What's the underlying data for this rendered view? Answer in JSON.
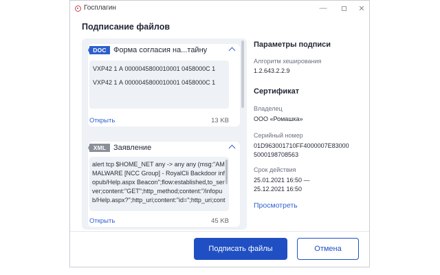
{
  "window": {
    "app_title": "Госплагин",
    "heading": "Подписание файлов"
  },
  "files": [
    {
      "badge": "DOC",
      "name": "Форма согласия на...тайну",
      "lines": [
        "VXP42   1 А 0000045800010001 0458000С 1",
        "VXP42   1 А 0000045800010001 0458000С 1"
      ],
      "open_label": "Открыть",
      "size": "13 KB"
    },
    {
      "badge": "XML",
      "name": "Заявление",
      "content": "alert tcp $HOME_NET any -> any any (msg:\"AM MALWARE [NCC Group] - RoyalCli Backdoor infopub/Help.aspx Beacon\";flow:established,to_server;content:\"GET\";http_method;content:\"/infopub/Help.aspx?\";http_uri;content:\"id=\";http_uri;cont",
      "open_label": "Открыть",
      "size": "45 KB"
    }
  ],
  "signature": {
    "params_title": "Параметры подписи",
    "hash_label": "Алгоритм хеширования",
    "hash_value": "1.2.643.2.2.9",
    "cert_title": "Сертификат",
    "owner_label": "Владелец",
    "owner_value": "ООО «Ромашка»",
    "serial_label": "Серийный номер",
    "serial_value": "01D963001710FF4000007E830005000198708563",
    "validity_label": "Срок действия",
    "validity_from": "25.01.2021 16:50 —",
    "validity_to": "25.12.2021 16:50",
    "view_link": "Просмотреть"
  },
  "buttons": {
    "sign": "Подписать файлы",
    "cancel": "Отмена"
  },
  "colors": {
    "accent": "#1f4fc2",
    "doc_badge": "#2b5fcf",
    "xml_badge": "#8a8f98"
  }
}
